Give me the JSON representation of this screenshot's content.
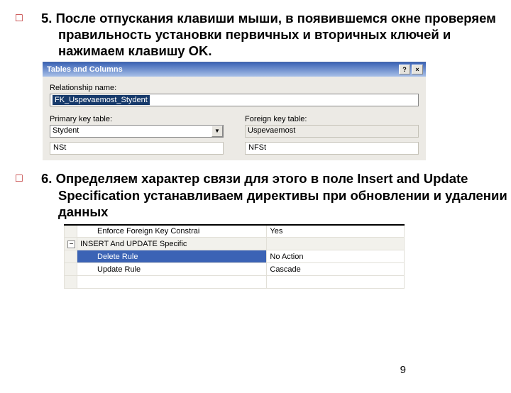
{
  "step5": {
    "text": "5. После отпускания клавиши мыши, в появившемся окне проверяем правильность установки первичных и вторичных ключей и нажимаем клавишу OK."
  },
  "step6": {
    "text": "6. Определяем характер связи для этого в поле Insert and Update Specification устанавливаем директивы при обновлении и удалении данных"
  },
  "page_number": "9",
  "dialog1": {
    "title": "Tables and Columns",
    "help_btn": "?",
    "close_btn": "×",
    "rel_label": "Relationship name:",
    "rel_value": "FK_Uspevaemost_Stydent",
    "pk_label": "Primary key table:",
    "fk_label": "Foreign key table:",
    "pk_table": "Stydent",
    "fk_table": "Uspevaemost",
    "pk_col": "NSt",
    "fk_col": "NFSt",
    "combo_arrow": "▼"
  },
  "propgrid": {
    "enforce_label": "Enforce Foreign Key Constrai",
    "enforce_value": "Yes",
    "section_label": "INSERT And UPDATE Specific",
    "expander": "−",
    "delete_label": "Delete Rule",
    "delete_value": "No Action",
    "update_label": "Update Rule",
    "update_value": "Cascade"
  }
}
